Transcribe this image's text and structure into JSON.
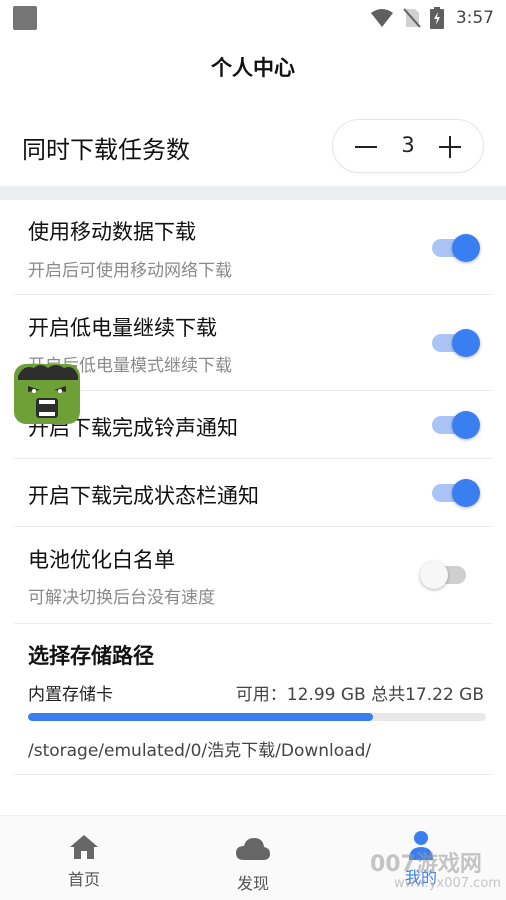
{
  "status_bar": {
    "time": "3:57"
  },
  "header": {
    "title": "个人中心"
  },
  "concurrent": {
    "label": "同时下载任务数",
    "value": "3"
  },
  "settings": [
    {
      "title": "使用移动数据下载",
      "subtitle": "开启后可使用移动网络下载",
      "enabled": true
    },
    {
      "title": "开启低电量继续下载",
      "subtitle": "开启后低电量模式继续下载",
      "enabled": true
    },
    {
      "title": "开启下载完成铃声通知",
      "subtitle": "",
      "enabled": true
    },
    {
      "title": "开启下载完成状态栏通知",
      "subtitle": "",
      "enabled": true
    },
    {
      "title": "电池优化白名单",
      "subtitle": "可解决切换后台没有速度",
      "enabled": false
    }
  ],
  "storage": {
    "title": "选择存储路径",
    "name": "内置存储卡",
    "info": "可用：12.99 GB 总共17.22 GB",
    "used_fraction": 0.754,
    "path": "/storage/emulated/0/浩克下载/Download/"
  },
  "bottom_nav": [
    {
      "label": "首页",
      "icon": "home-icon",
      "active": false
    },
    {
      "label": "发现",
      "icon": "cloud-icon",
      "active": false
    },
    {
      "label": "我的",
      "icon": "person-icon",
      "active": true
    }
  ],
  "watermark": {
    "big": "007游戏网",
    "small": "www.yx007.com"
  },
  "colors": {
    "accent": "#3a7ff2",
    "divider": "#eceff1"
  }
}
